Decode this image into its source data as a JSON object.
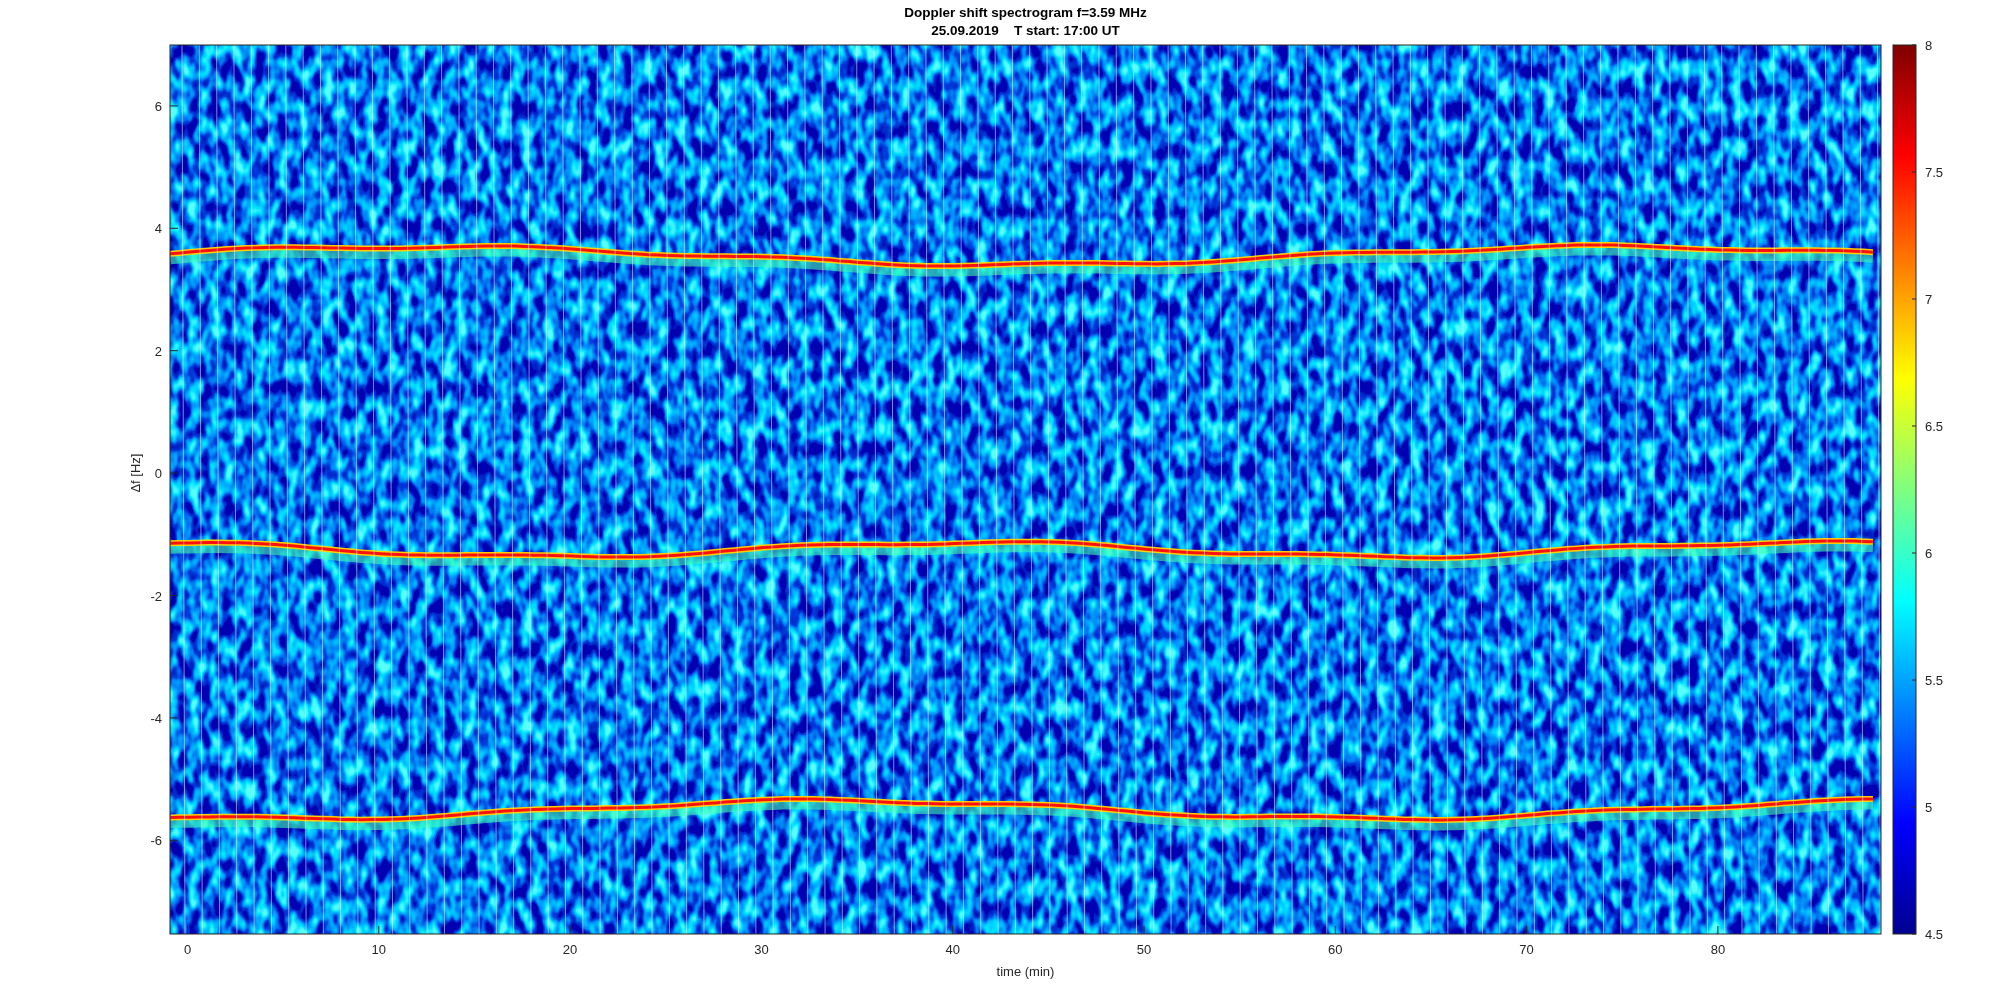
{
  "figure": {
    "title_lines": [
      "Doppler shift spectrogram f=3.59 MHz",
      "25.09.2019    T start: 17:00 UT"
    ],
    "xlabel": "time (min)",
    "ylabel": "Δf [Hz]",
    "xticks": [
      "0",
      "10",
      "20",
      "30",
      "40",
      "50",
      "60",
      "70",
      "80"
    ],
    "yticks": [
      "6",
      "4",
      "2",
      "0",
      "-2",
      "-4",
      "-6"
    ],
    "colorbar_ticks": [
      "8",
      "7.5",
      "7",
      "6.5",
      "6",
      "5.5",
      "5",
      "4.5"
    ]
  }
}
